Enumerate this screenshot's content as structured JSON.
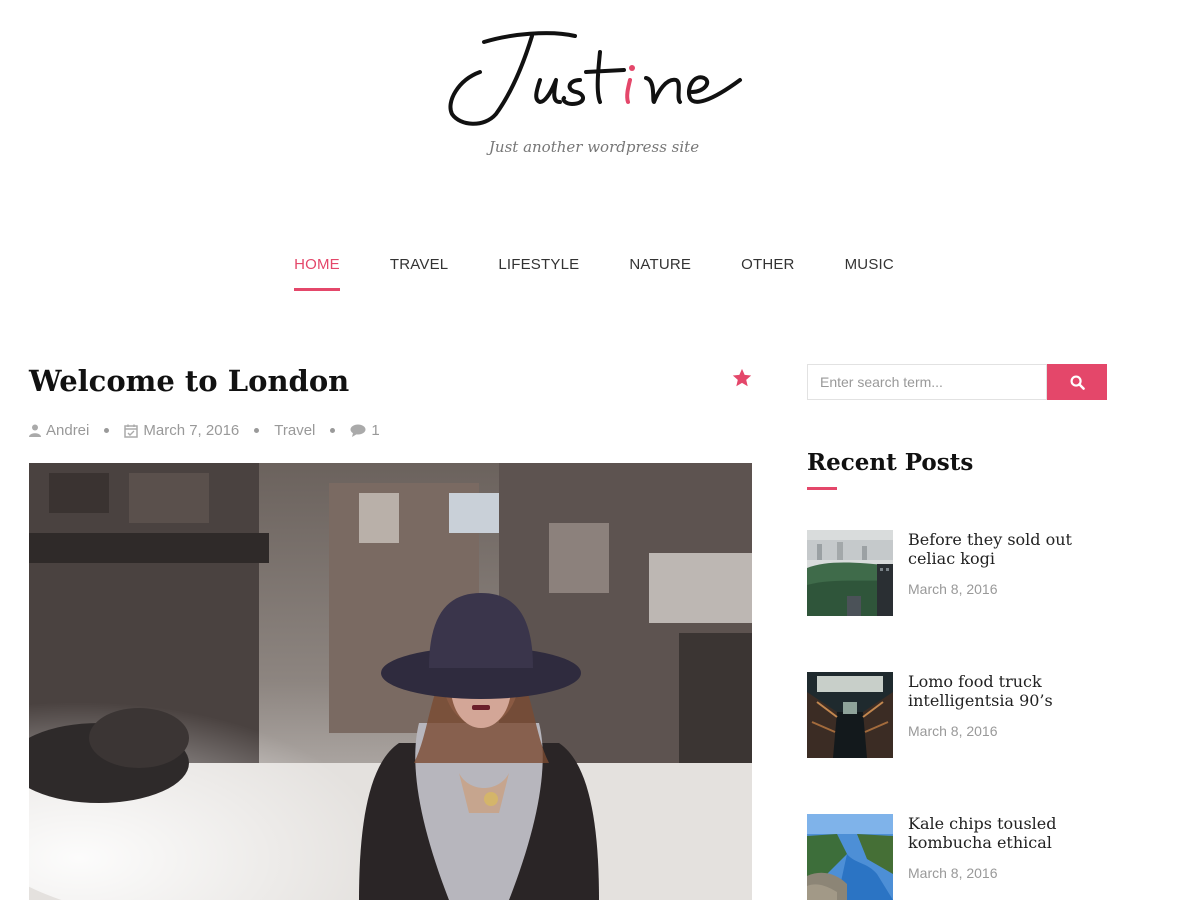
{
  "site": {
    "logo_text": "Justine",
    "tagline": "Just another wordpress site",
    "accent_color": "#e4476a"
  },
  "nav": {
    "items": [
      {
        "label": "HOME",
        "active": true
      },
      {
        "label": "TRAVEL",
        "active": false
      },
      {
        "label": "LIFESTYLE",
        "active": false
      },
      {
        "label": "NATURE",
        "active": false
      },
      {
        "label": "OTHER",
        "active": false
      },
      {
        "label": "MUSIC",
        "active": false
      }
    ]
  },
  "post": {
    "title": "Welcome to London",
    "featured_icon": "star-icon",
    "author": "Andrei",
    "date": "March 7, 2016",
    "category": "Travel",
    "comments": "1",
    "image_alt": "woman-in-hat-london-street"
  },
  "sidebar": {
    "search": {
      "placeholder": "Enter search term...",
      "button_icon": "search-icon"
    },
    "recent_title": "Recent Posts",
    "recent_posts": [
      {
        "title": "Before they sold out celiac kogi",
        "date": "March 8, 2016"
      },
      {
        "title": "Lomo food truck intelligentsia 90’s",
        "date": "March 8, 2016"
      },
      {
        "title": "Kale chips tousled kombucha ethical",
        "date": "March 8, 2016"
      }
    ]
  }
}
